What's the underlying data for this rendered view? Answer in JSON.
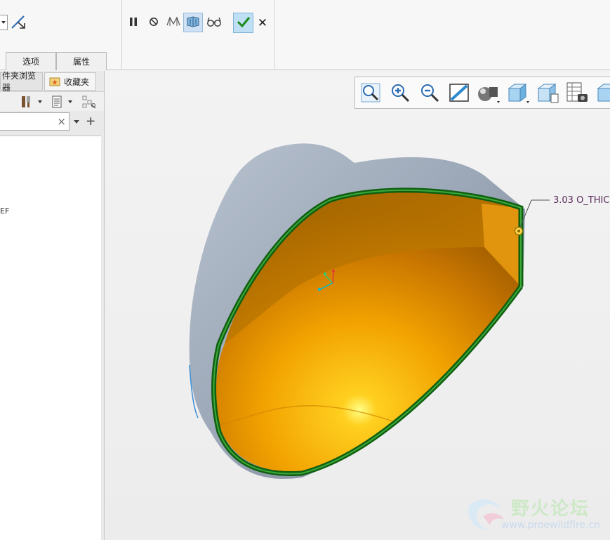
{
  "ribbon": {
    "tabs": [
      {
        "label": "选项"
      },
      {
        "label": "属性"
      }
    ],
    "controls": {
      "pause": "pause-icon",
      "no_preview": "no-preview-icon",
      "verify": "verify-icon",
      "feature_preview": "feature-preview-icon",
      "glasses": "glasses-icon",
      "ok": "checkmark-icon",
      "cancel_label": "✕"
    }
  },
  "left_panel": {
    "tabs": [
      {
        "label": "件夹浏览器"
      },
      {
        "label": "收藏夹"
      }
    ],
    "search": {
      "value": "",
      "clear": "×"
    },
    "tree_fragment": "EF"
  },
  "view_toolbar": {
    "buttons": [
      "zoom-fit-icon",
      "zoom-in-icon",
      "zoom-out-icon",
      "repaint-icon",
      "display-style-icon",
      "saved-orientations-icon",
      "view-manager-icon",
      "layers-icon",
      "snapshot-icon"
    ]
  },
  "model": {
    "dimension_label": "3.03 O_THIC",
    "colors": {
      "outer_shell": "#9aa6b6",
      "inner_face": "#f0a000",
      "edge_highlight": "#1a7a1a",
      "dimension_text": "#5a2a5a"
    }
  },
  "watermark": {
    "title": "野火论坛",
    "url": "www.proewildfire.cn"
  }
}
